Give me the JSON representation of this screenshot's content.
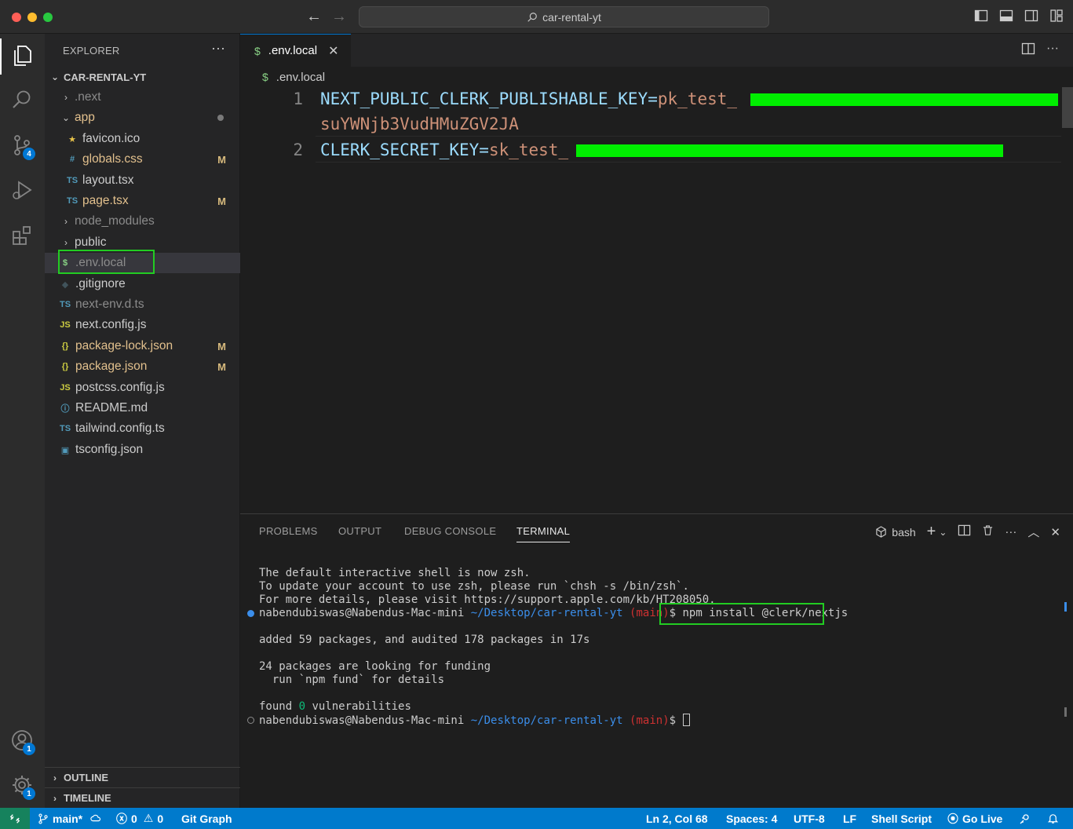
{
  "titlebar": {
    "search_text": "car-rental-yt"
  },
  "activity": {
    "scm_badge": "4",
    "accounts_badge": "1",
    "manage_badge": "1"
  },
  "explorer": {
    "header": "EXPLORER",
    "more": "···",
    "project": "CAR-RENTAL-YT",
    "items": [
      {
        "label": ".next",
        "type": "folder-collapsed",
        "status": ""
      },
      {
        "label": "app",
        "type": "folder-expanded",
        "status": "dot"
      },
      {
        "label": "favicon.ico",
        "type": "ico",
        "status": ""
      },
      {
        "label": "globals.css",
        "type": "css",
        "status": "M"
      },
      {
        "label": "layout.tsx",
        "type": "ts",
        "status": ""
      },
      {
        "label": "page.tsx",
        "type": "ts",
        "status": "M"
      },
      {
        "label": "node_modules",
        "type": "folder-collapsed",
        "status": ""
      },
      {
        "label": "public",
        "type": "folder-collapsed",
        "status": ""
      },
      {
        "label": ".env.local",
        "type": "env",
        "status": ""
      },
      {
        "label": ".gitignore",
        "type": "git",
        "status": ""
      },
      {
        "label": "next-env.d.ts",
        "type": "ts",
        "status": ""
      },
      {
        "label": "next.config.js",
        "type": "js",
        "status": ""
      },
      {
        "label": "package-lock.json",
        "type": "json",
        "status": "M"
      },
      {
        "label": "package.json",
        "type": "json",
        "status": "M"
      },
      {
        "label": "postcss.config.js",
        "type": "js",
        "status": ""
      },
      {
        "label": "README.md",
        "type": "info",
        "status": ""
      },
      {
        "label": "tailwind.config.ts",
        "type": "ts",
        "status": ""
      },
      {
        "label": "tsconfig.json",
        "type": "tsconfig",
        "status": ""
      }
    ],
    "outline": "OUTLINE",
    "timeline": "TIMELINE"
  },
  "editor": {
    "tab_label": ".env.local",
    "tab_icon": "$",
    "breadcrumb": ".env.local",
    "lines": [
      {
        "number": "1",
        "key": "NEXT_PUBLIC_CLERK_PUBLISHABLE_KEY",
        "eq": "=",
        "value": "pk_test_",
        "wrap": "suYWNjb3VudHMuZGV2JA"
      },
      {
        "number": "2",
        "key": "CLERK_SECRET_KEY",
        "eq": "=",
        "value": "sk_test_"
      }
    ]
  },
  "panel": {
    "tabs": [
      "PROBLEMS",
      "OUTPUT",
      "DEBUG CONSOLE",
      "TERMINAL"
    ],
    "active_tab": "TERMINAL",
    "shell": "bash",
    "terminal": {
      "intro": [
        "The default interactive shell is now zsh.",
        "To update your account to use zsh, please run `chsh -s /bin/zsh`.",
        "For more details, please visit https://support.apple.com/kb/HT208050."
      ],
      "prompt_user": "nabendubiswas@Nabendus-Mac-mini",
      "prompt_path": "~/Desktop/car-rental-yt",
      "prompt_branch": "(main)",
      "prompt_symbol": "$",
      "command": "npm install @clerk/nextjs",
      "output_added": "added 59 packages, and audited 178 packages in 17s",
      "output_funding_1": "24 packages are looking for funding",
      "output_funding_2": "  run `npm fund` for details",
      "output_found": "found ",
      "output_zero": "0",
      "output_vuln": " vulnerabilities"
    }
  },
  "statusbar": {
    "branch": "main*",
    "errors": "0",
    "warnings": "0",
    "git_graph": "Git Graph",
    "position": "Ln 2, Col 68",
    "spaces": "Spaces: 4",
    "encoding": "UTF-8",
    "eol": "LF",
    "language": "Shell Script",
    "go_live": "Go Live"
  }
}
